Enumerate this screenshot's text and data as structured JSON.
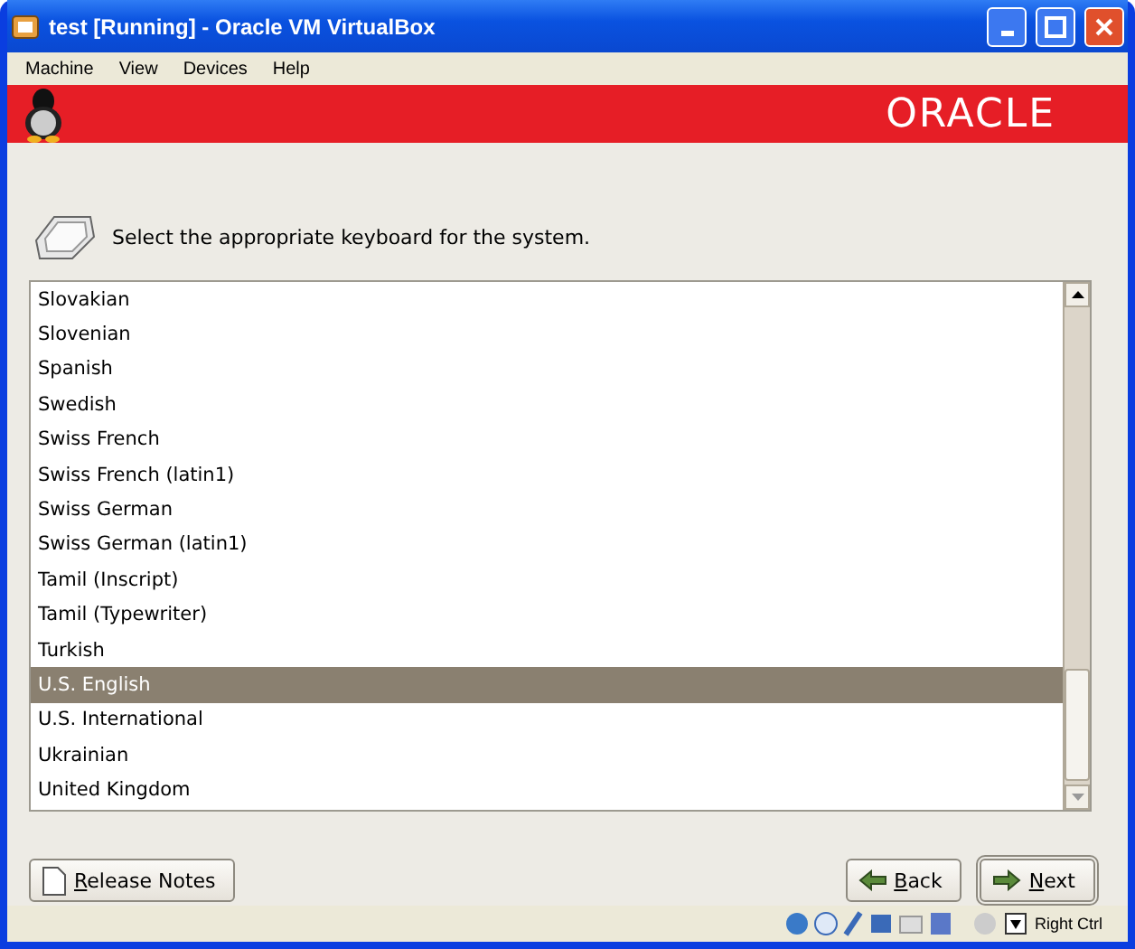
{
  "window": {
    "title": "test [Running] - Oracle VM VirtualBox"
  },
  "menu": [
    "Machine",
    "View",
    "Devices",
    "Help"
  ],
  "banner": {
    "logo": "ORACLE"
  },
  "prompt": "Select the appropriate keyboard for the system.",
  "keyboards": [
    {
      "label": "Slovakian",
      "selected": false
    },
    {
      "label": "Slovenian",
      "selected": false
    },
    {
      "label": "Spanish",
      "selected": false
    },
    {
      "label": "Swedish",
      "selected": false
    },
    {
      "label": "Swiss French",
      "selected": false
    },
    {
      "label": "Swiss French (latin1)",
      "selected": false
    },
    {
      "label": "Swiss German",
      "selected": false
    },
    {
      "label": "Swiss German (latin1)",
      "selected": false
    },
    {
      "label": "Tamil (Inscript)",
      "selected": false
    },
    {
      "label": "Tamil (Typewriter)",
      "selected": false
    },
    {
      "label": "Turkish",
      "selected": false
    },
    {
      "label": "U.S. English",
      "selected": true
    },
    {
      "label": "U.S. International",
      "selected": false
    },
    {
      "label": "Ukrainian",
      "selected": false
    },
    {
      "label": "United Kingdom",
      "selected": false
    }
  ],
  "buttons": [
    {
      "kind": "notes",
      "label": "Release Notes"
    },
    {
      "kind": "back",
      "label": "Back"
    },
    {
      "kind": "next",
      "label": "Next"
    }
  ],
  "status_bar": {
    "host_key": "Right Ctrl"
  }
}
